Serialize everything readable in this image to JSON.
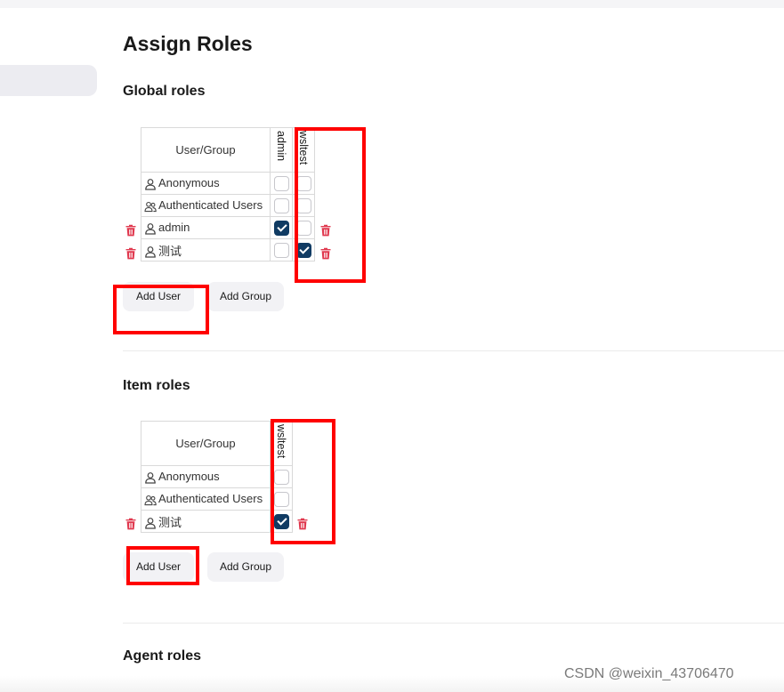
{
  "page": {
    "title": "Assign Roles"
  },
  "global_roles": {
    "title": "Global roles",
    "header": "User/Group",
    "roles": [
      "admin",
      "wsltest"
    ],
    "rows": [
      {
        "name": "Anonymous",
        "icon": "user-icon",
        "checks": [
          false,
          false
        ],
        "deletable": false
      },
      {
        "name": "Authenticated Users",
        "icon": "group-icon",
        "checks": [
          false,
          false
        ],
        "deletable": false
      },
      {
        "name": "admin",
        "icon": "user-icon",
        "checks": [
          true,
          false
        ],
        "deletable": true
      },
      {
        "name": "测试",
        "icon": "user-icon",
        "checks": [
          false,
          true
        ],
        "deletable": true
      }
    ],
    "add_user_label": "Add User",
    "add_group_label": "Add Group"
  },
  "item_roles": {
    "title": "Item roles",
    "header": "User/Group",
    "roles": [
      "wsltest"
    ],
    "rows": [
      {
        "name": "Anonymous",
        "icon": "user-icon",
        "checks": [
          false
        ],
        "deletable": false
      },
      {
        "name": "Authenticated Users",
        "icon": "group-icon",
        "checks": [
          false
        ],
        "deletable": false
      },
      {
        "name": "测试",
        "icon": "user-icon",
        "checks": [
          true
        ],
        "deletable": true
      }
    ],
    "add_user_label": "Add User",
    "add_group_label": "Add Group"
  },
  "agent_roles": {
    "title": "Agent roles"
  },
  "watermark": "CSDN @weixin_43706470",
  "colors": {
    "checked": "#103b63",
    "trash": "#e0384e",
    "highlight_box": "#ff0000"
  }
}
